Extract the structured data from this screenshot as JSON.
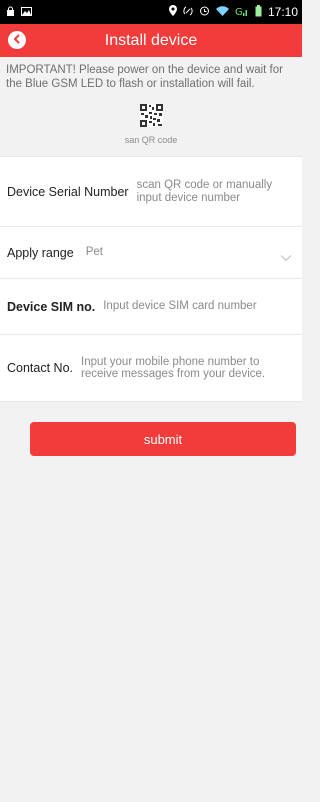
{
  "status_bar": {
    "time": "17:10",
    "icons": [
      "lock-icon",
      "image-icon",
      "location-pin-icon",
      "nfc-icon",
      "alarm-icon",
      "wifi-icon",
      "signal-g-icon",
      "battery-icon"
    ]
  },
  "header": {
    "title": "Install device",
    "back_icon": "back-arrow-icon"
  },
  "notice": "IMPORTANT! Please power on the device and wait for the Blue GSM LED to flash or installation will fail.",
  "qr": {
    "icon": "qr-code-icon",
    "label": "san QR code"
  },
  "form": {
    "serial": {
      "label": "Device Serial Number",
      "placeholder": "scan QR code or manually input device number"
    },
    "apply_range": {
      "label": "Apply range",
      "value": "Pet",
      "icon": "chevron-down-icon"
    },
    "sim": {
      "label": "Device SIM no.",
      "placeholder": "Input device SIM card number"
    },
    "contact": {
      "label": "Contact No.",
      "placeholder": "Input your mobile phone number to receive messages from your device."
    }
  },
  "submit_label": "submit",
  "colors": {
    "accent": "#f23b3b",
    "background": "#f2f2f2"
  }
}
